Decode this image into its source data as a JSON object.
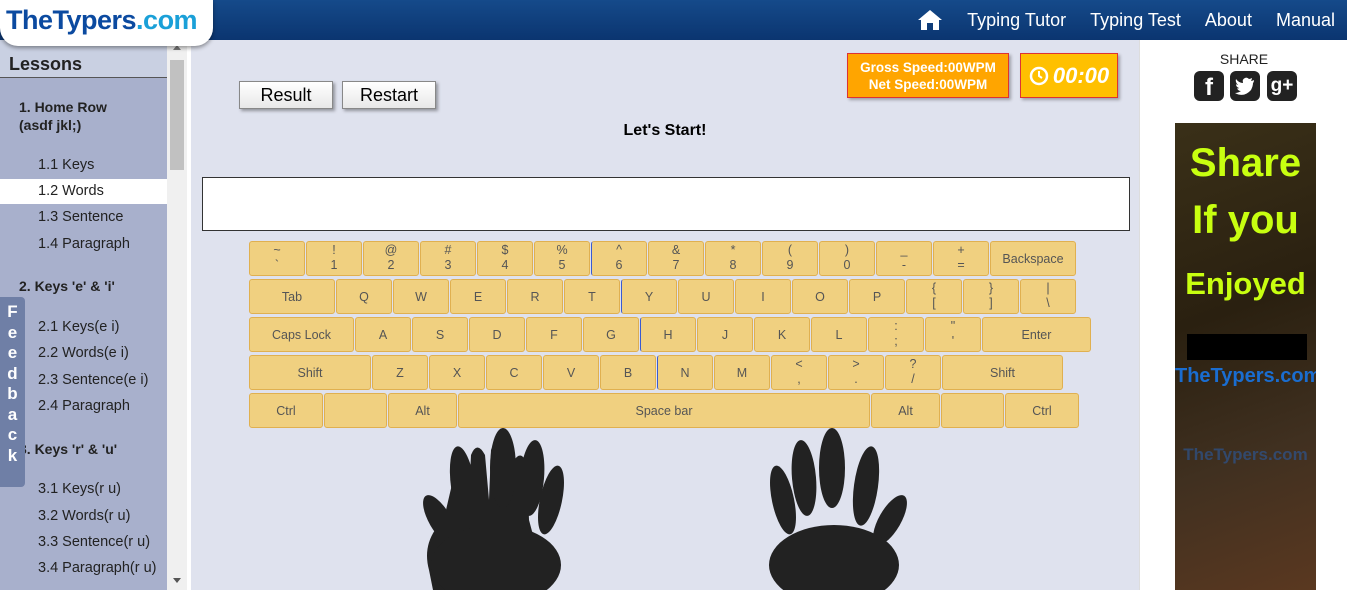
{
  "header": {
    "logo_part1": "TheTypers",
    "logo_part2": ".com",
    "nav": [
      "Typing Tutor",
      "Typing Test",
      "About",
      "Manual"
    ],
    "home_icon": "home-icon"
  },
  "sidebar": {
    "title": "Lessons",
    "sections": [
      {
        "title": "1. Home Row (asdf jkl;)",
        "items": [
          "1.1 Keys",
          "1.2 Words",
          "1.3 Sentence",
          "1.4 Paragraph"
        ]
      },
      {
        "title": "2. Keys 'e' & 'i'",
        "items": [
          "2.1 Keys(e i)",
          "2.2 Words(e i)",
          "2.3 Sentence(e i)",
          "2.4 Paragraph"
        ]
      },
      {
        "title": "3. Keys 'r' & 'u'",
        "items": [
          "3.1 Keys(r u)",
          "3.2 Words(r u)",
          "3.3 Sentence(r u)",
          "3.4 Paragraph(r u)"
        ]
      }
    ],
    "active_item": "1.2 Words",
    "feedback": "Feedback"
  },
  "main": {
    "result_button": "Result",
    "restart_button": "Restart",
    "status": "Let's Start!",
    "gross_speed": "Gross Speed:00WPM",
    "net_speed": "Net Speed:00WPM",
    "timer": "00:00",
    "typing_input_value": ""
  },
  "keyboard": {
    "rows": [
      [
        [
          "~",
          "`"
        ],
        [
          "!",
          "1"
        ],
        [
          "@",
          "2"
        ],
        [
          "#",
          "3"
        ],
        [
          "$",
          "4"
        ],
        [
          "%",
          "5"
        ],
        [
          "^",
          "6"
        ],
        [
          "&",
          "7"
        ],
        [
          "*",
          "8"
        ],
        [
          "(",
          "9"
        ],
        [
          ")",
          "0"
        ],
        [
          "_",
          "-"
        ],
        [
          "+",
          "="
        ],
        [
          "Backspace"
        ]
      ],
      [
        [
          "Tab"
        ],
        [
          "Q"
        ],
        [
          "W"
        ],
        [
          "E"
        ],
        [
          "R"
        ],
        [
          "T"
        ],
        [
          "Y"
        ],
        [
          "U"
        ],
        [
          "I"
        ],
        [
          "O"
        ],
        [
          "P"
        ],
        [
          "{",
          "["
        ],
        [
          "}",
          "]"
        ],
        [
          "|",
          "\\"
        ]
      ],
      [
        [
          "Caps Lock"
        ],
        [
          "A"
        ],
        [
          "S"
        ],
        [
          "D"
        ],
        [
          "F"
        ],
        [
          "G"
        ],
        [
          "H"
        ],
        [
          "J"
        ],
        [
          "K"
        ],
        [
          "L"
        ],
        [
          ":",
          ";"
        ],
        [
          "\"",
          "'"
        ],
        [
          "Enter"
        ]
      ],
      [
        [
          "Shift"
        ],
        [
          "Z"
        ],
        [
          "X"
        ],
        [
          "C"
        ],
        [
          "V"
        ],
        [
          "B"
        ],
        [
          "N"
        ],
        [
          "M"
        ],
        [
          "<",
          ","
        ],
        [
          ">",
          "."
        ],
        [
          "?",
          "/"
        ],
        [
          "Shift"
        ]
      ],
      [
        [
          "Ctrl"
        ],
        [
          ""
        ],
        [
          "Alt"
        ],
        [
          "Space bar"
        ],
        [
          "Alt"
        ],
        [
          ""
        ],
        [
          "Ctrl"
        ]
      ]
    ]
  },
  "share": {
    "label": "SHARE",
    "icons": [
      "facebook-icon",
      "twitter-icon",
      "google-plus-icon"
    ]
  },
  "ad": {
    "line1": "Share",
    "line2": "If you",
    "line3": "Enjoyed",
    "brand": "TheTypers.com",
    "brand2": "TheTypers.com"
  },
  "colors": {
    "header": "#0b3570",
    "sidebar": "#a8b0cc",
    "main_bg": "#dfe2ee",
    "key": "#f0d080",
    "speed_box": "#ffa500",
    "timer_box": "#ffc000"
  }
}
